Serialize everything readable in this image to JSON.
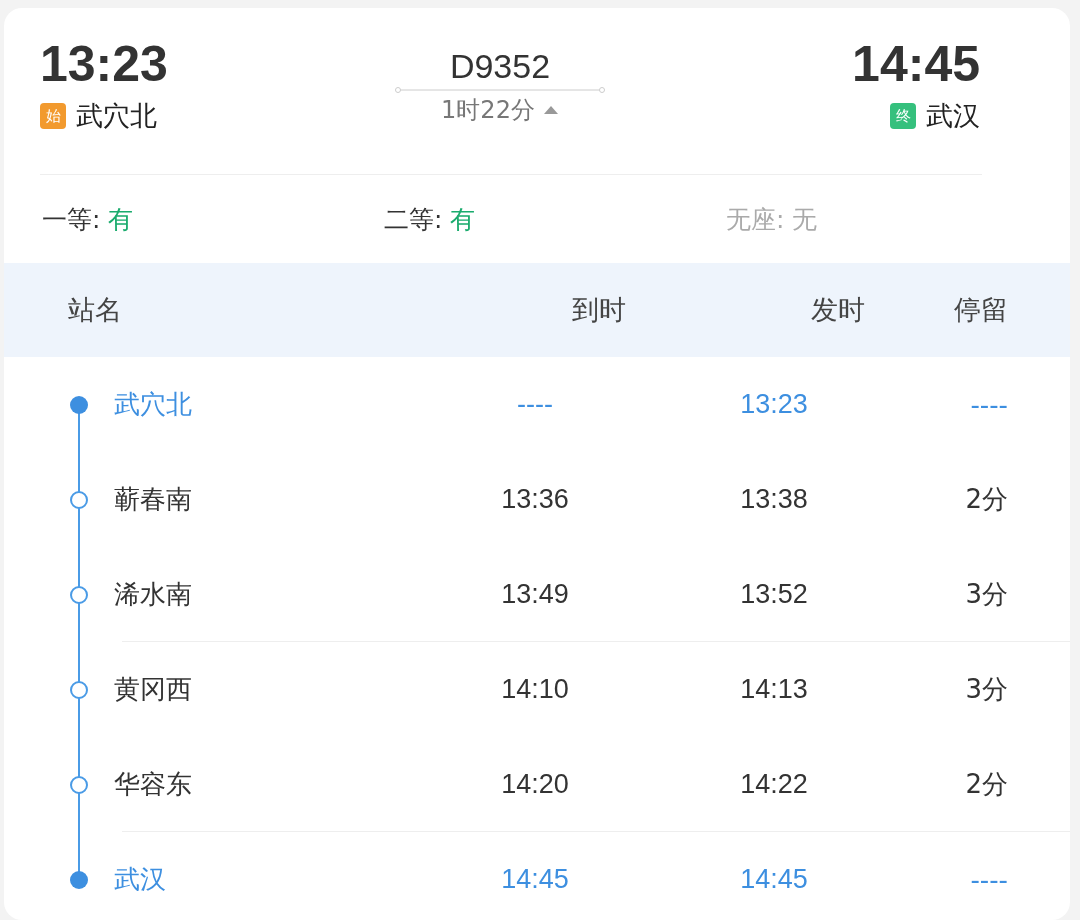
{
  "journey": {
    "depart_time": "13:23",
    "depart_badge": "始",
    "depart_station": "武穴北",
    "train_number": "D9352",
    "duration": "1时22分",
    "expanded": true,
    "arrive_time": "14:45",
    "arrive_badge": "终",
    "arrive_station": "武汉"
  },
  "seats": [
    {
      "label": "一等: ",
      "value": "有",
      "available": true
    },
    {
      "label": "二等: ",
      "value": "有",
      "available": true
    },
    {
      "label": "无座: ",
      "value": "无",
      "available": false
    }
  ],
  "table": {
    "columns": [
      "站名",
      "到时",
      "发时",
      "停留"
    ],
    "rows": [
      {
        "kind": "terminal",
        "station": "武穴北",
        "arrival": "----",
        "departure": "13:23",
        "stop": "----",
        "divider_below": false
      },
      {
        "kind": "intermediate",
        "station": "蕲春南",
        "arrival": "13:36",
        "departure": "13:38",
        "stop": "2分",
        "divider_below": false
      },
      {
        "kind": "intermediate",
        "station": "浠水南",
        "arrival": "13:49",
        "departure": "13:52",
        "stop": "3分",
        "divider_below": true
      },
      {
        "kind": "intermediate",
        "station": "黄冈西",
        "arrival": "14:10",
        "departure": "14:13",
        "stop": "3分",
        "divider_below": false
      },
      {
        "kind": "intermediate",
        "station": "华容东",
        "arrival": "14:20",
        "departure": "14:22",
        "stop": "2分",
        "divider_below": true
      },
      {
        "kind": "terminal",
        "station": "武汉",
        "arrival": "14:45",
        "departure": "14:45",
        "stop": "----",
        "divider_below": false
      }
    ]
  }
}
